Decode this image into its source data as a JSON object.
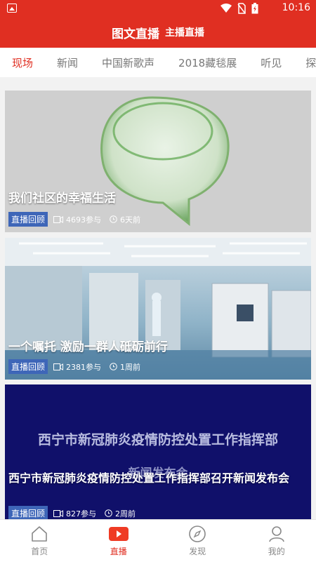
{
  "status_bar": {
    "time": "10:16"
  },
  "header": {
    "title": "图文直播",
    "subtitle": "主播直播"
  },
  "tabs": [
    "现场",
    "新闻",
    "中国新歌声",
    "2018藏毯展",
    "听见",
    "探秘"
  ],
  "cards": [
    {
      "title": "我们社区的幸福生活",
      "badge": "直播回顾",
      "participants": "4693参与",
      "time": "6天前"
    },
    {
      "title": "一个嘱托 激励一群人砥砺前行",
      "badge": "直播回顾",
      "participants": "2381参与",
      "time": "1周前"
    },
    {
      "title": "西宁市新冠肺炎疫情防控处置工作指挥部召开新闻发布会",
      "badge": "直播回顾",
      "participants": "827参与",
      "time": "2周前",
      "slide_line1": "西宁市新冠肺炎疫情防控处置工作指挥部",
      "slide_line2": "新闻发布会"
    }
  ],
  "bottom_nav": [
    "首页",
    "直播",
    "发现",
    "我的"
  ],
  "colors": {
    "accent": "#e02f22",
    "badge": "#3e66b8",
    "slide_bg": "#10106a"
  }
}
